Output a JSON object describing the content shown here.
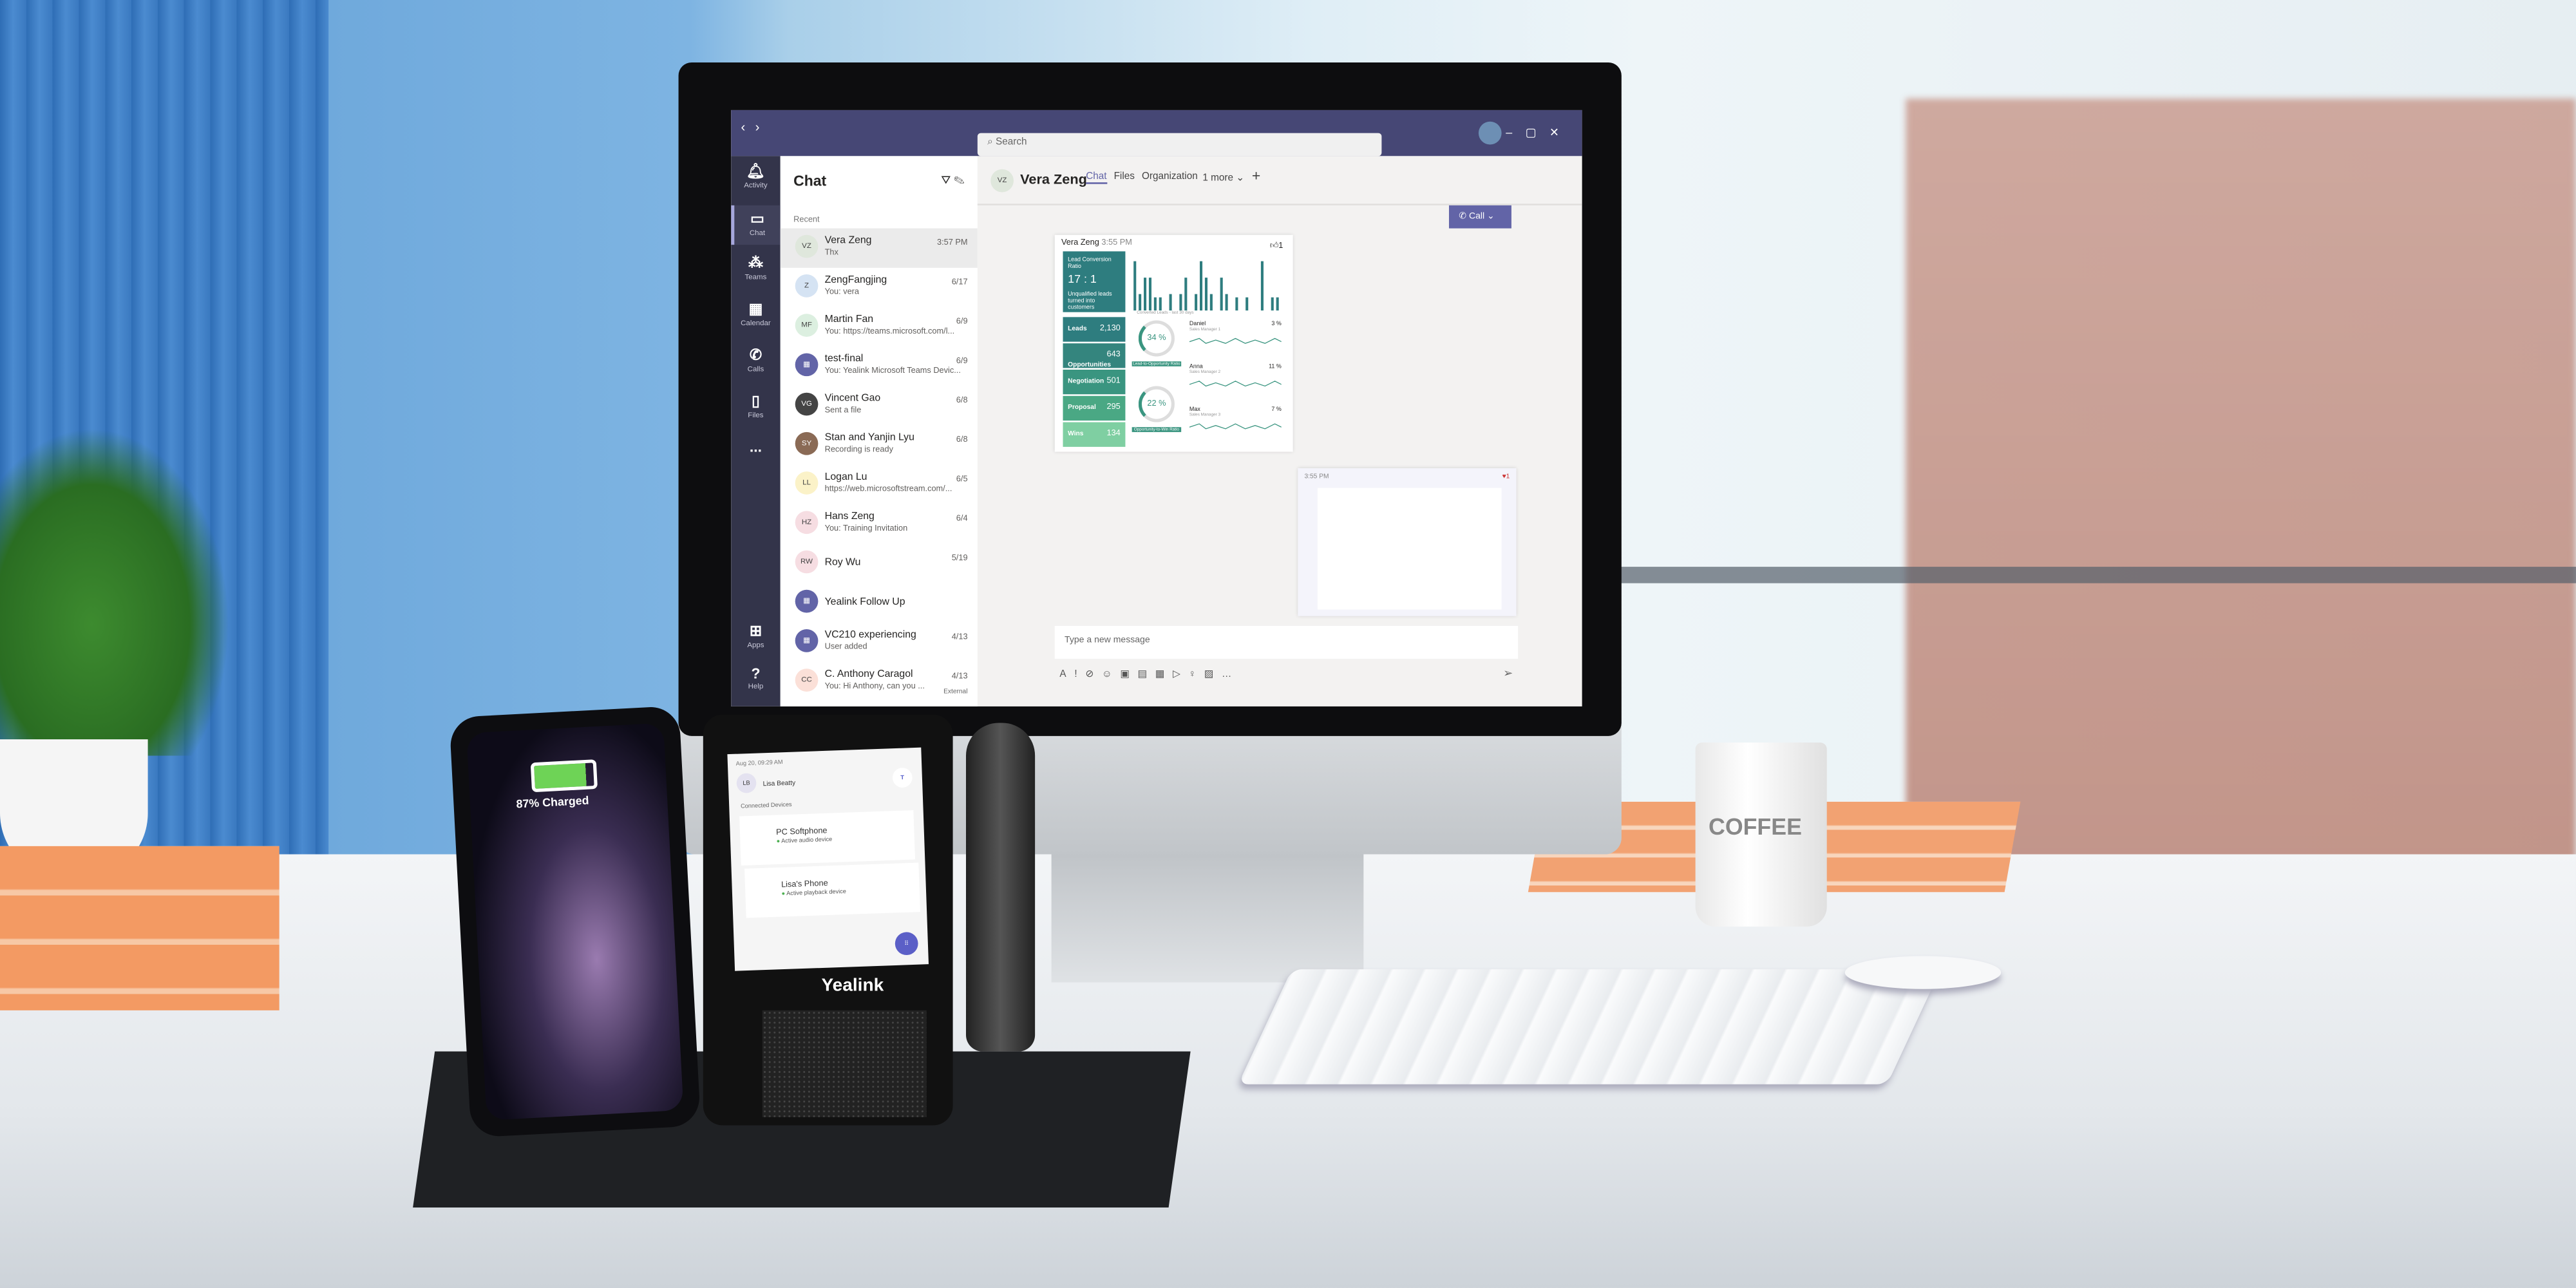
{
  "scene": {
    "brand": "Yealink",
    "mug_text": "COFFEE",
    "phone_status": "87% Charged",
    "battery_level": 0.87
  },
  "teams": {
    "search_placeholder": "Search",
    "rail": [
      "Activity",
      "Chat",
      "Teams",
      "Calendar",
      "Calls",
      "Files",
      "...",
      "Apps",
      "Help"
    ],
    "list": {
      "title": "Chat",
      "section": "Recent",
      "items": [
        {
          "initials": "VZ",
          "name": "Vera Zeng",
          "preview": "Thx",
          "date": "3:57 PM",
          "color": "#dfe7dc"
        },
        {
          "initials": "Z",
          "name": "ZengFangjing",
          "preview": "You: vera",
          "date": "6/17",
          "color": "#d5e3f3"
        },
        {
          "initials": "MF",
          "name": "Martin Fan",
          "preview": "You: https://teams.microsoft.com/l...",
          "date": "6/9",
          "color": "#dcefe0"
        },
        {
          "initials": "▦",
          "name": "test-final",
          "preview": "You: Yealink Microsoft Teams Devic...",
          "date": "6/9",
          "color": "#6264a7"
        },
        {
          "initials": "VG",
          "name": "Vincent Gao",
          "preview": "Sent a file",
          "date": "6/8",
          "color": "#444"
        },
        {
          "initials": "SY",
          "name": "Stan and Yanjin Lyu",
          "preview": "Recording is ready",
          "date": "6/8",
          "color": "#8a6a55"
        },
        {
          "initials": "LL",
          "name": "Logan Lu",
          "preview": "https://web.microsoftstream.com/...",
          "date": "6/5",
          "color": "#fbf2c8"
        },
        {
          "initials": "HZ",
          "name": "Hans Zeng",
          "preview": "You: Training Invitation",
          "date": "6/4",
          "color": "#f6dde2"
        },
        {
          "initials": "RW",
          "name": "Roy Wu",
          "preview": "",
          "date": "5/19",
          "color": "#f6dde2"
        },
        {
          "initials": "▦",
          "name": "Yealink Follow Up",
          "preview": "",
          "date": "",
          "color": "#6264a7"
        },
        {
          "initials": "▦",
          "name": "VC210 experiencing",
          "preview": "User added",
          "date": "4/13",
          "color": "#6264a7"
        },
        {
          "initials": "CC",
          "name": "C. Anthony Caragol",
          "preview": "You: Hi Anthony, can you ...",
          "date": "4/13",
          "color": "#fbe0d8"
        }
      ],
      "external_label": "External"
    },
    "header": {
      "initials": "VZ",
      "name": "Vera Zeng",
      "tabs": [
        "Chat",
        "Files",
        "Organization",
        "1 more ⌄",
        "+"
      ],
      "call": "Call"
    },
    "message": {
      "sender": "Vera Zeng",
      "time": "3:55 PM",
      "reaction": "1",
      "dashboard": {
        "title": "Lead Conversion Ratio",
        "ratio": "17 : 1",
        "ratio_caption": "Unqualified leads turned into customers",
        "bar_caption": "Converted Leads - last 30 days",
        "tiles": [
          {
            "label": "Leads",
            "value": "2,130",
            "color": "#2e7d7f"
          },
          {
            "label": "Opportunities",
            "value": "643",
            "color": "#34857e"
          },
          {
            "label": "Negotiation",
            "value": "501",
            "color": "#3a9580"
          },
          {
            "label": "Proposal",
            "value": "295",
            "color": "#4aa884"
          },
          {
            "label": "Wins",
            "value": "134",
            "color": "#7fcfa2"
          }
        ],
        "gauges": [
          {
            "value": "34 %",
            "label": "Lead-to-Opportunity Ratio"
          },
          {
            "value": "22 %",
            "label": "Opportunity-to-Win Ratio"
          }
        ],
        "managers": [
          {
            "name": "Daniel",
            "role": "Sales Manager 1",
            "rate": "3 %"
          },
          {
            "name": "Anna",
            "role": "Sales Manager 2",
            "rate": "11 %"
          },
          {
            "name": "Max",
            "role": "Sales Manager 3",
            "rate": "7 %"
          }
        ]
      }
    },
    "message2": {
      "time": "3:55 PM",
      "reaction": "1"
    },
    "compose_placeholder": "Type a new message"
  },
  "desk_device": {
    "datetime": "Aug 20, 09:29 AM",
    "user_initials": "LB",
    "user": "Lisa Beatty",
    "section": "Connected Devices",
    "devices": [
      {
        "name": "PC Softphone",
        "status": "Active audio device"
      },
      {
        "name": "Lisa's Phone",
        "status": "Active playback device"
      }
    ]
  }
}
